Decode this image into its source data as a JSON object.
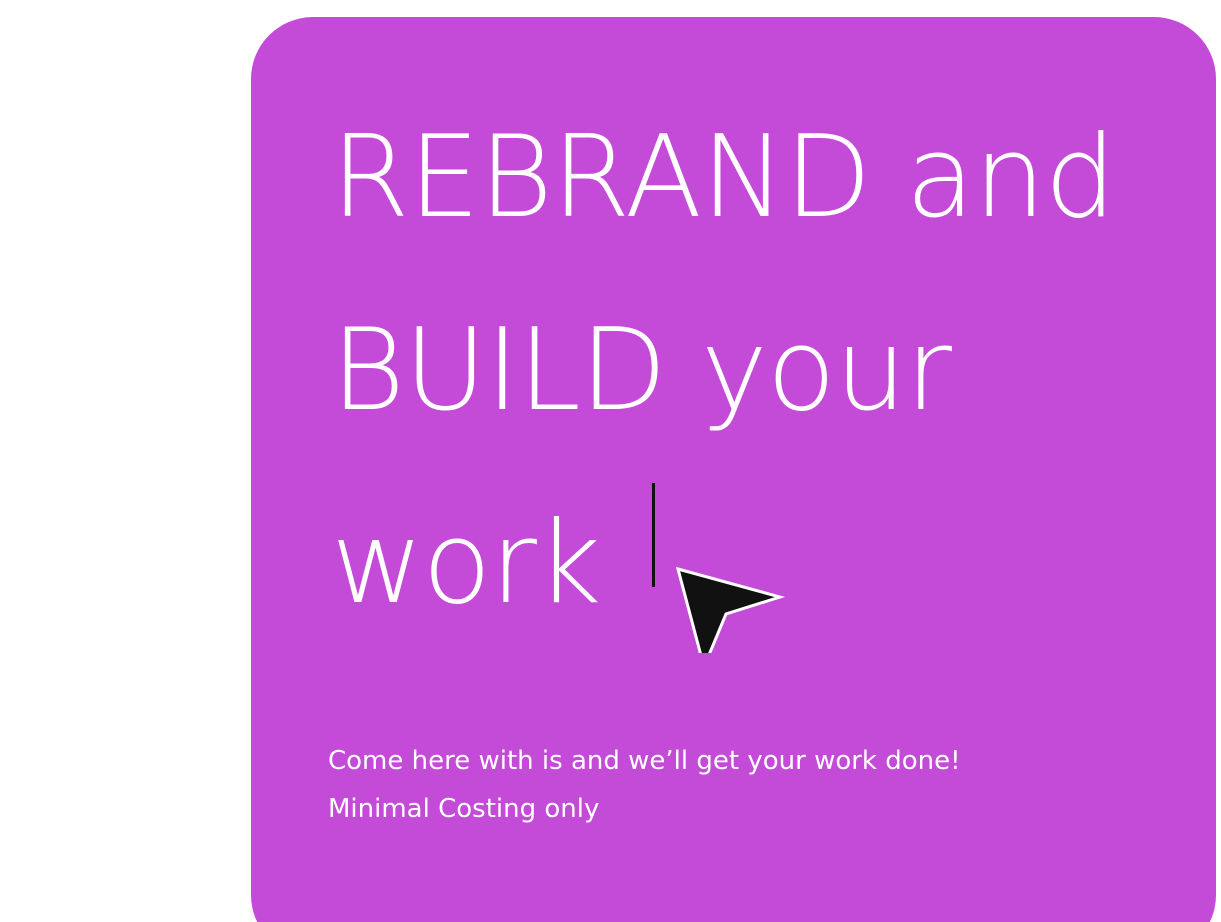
{
  "hero": {
    "title_line_1": "REBRAND and",
    "title_line_2": "BUILD your",
    "title_line_3": "work",
    "subtitle_line_1": "Come here with is and we’ll get your work done!",
    "subtitle_line_2": "Minimal Costing only"
  },
  "colors": {
    "card_background": "#c44bd8",
    "page_background": "#ffffff",
    "text": "#ffffff",
    "cursor": "#111111"
  },
  "icons": {
    "cursor": "mouse-pointer-arrow-icon",
    "caret": "text-caret-icon"
  }
}
